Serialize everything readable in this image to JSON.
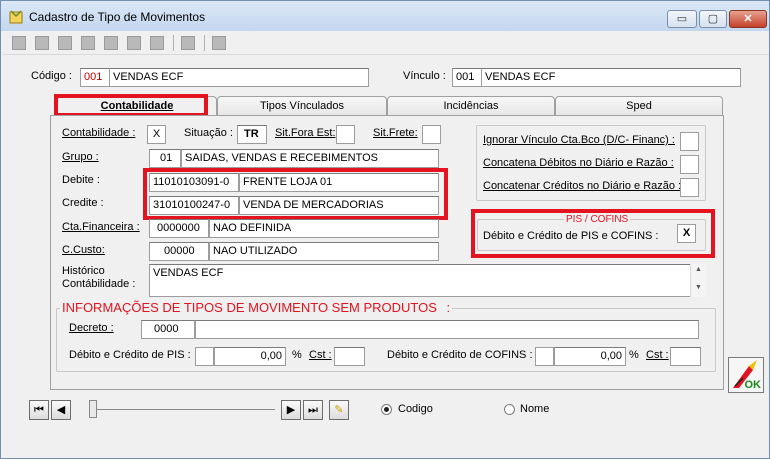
{
  "window": {
    "title": "Cadastro de Tipo de Movimentos",
    "min_glyph": "▭",
    "max_glyph": "▢",
    "close_glyph": "✕"
  },
  "header": {
    "codigo_label": "Código :",
    "codigo_code": "001",
    "codigo_desc": "VENDAS ECF",
    "vinculo_label": "Vínculo :",
    "vinculo_code": "001",
    "vinculo_desc": "VENDAS ECF"
  },
  "tabs": [
    {
      "label": "Contabilidade",
      "active": true
    },
    {
      "label": "Tipos Vínculados",
      "active": false
    },
    {
      "label": "Incidências",
      "active": false
    },
    {
      "label": "Sped",
      "active": false
    }
  ],
  "contab": {
    "contabilidade_label": "Contabilidade :",
    "contabilidade_value": "X",
    "situacao_label": "Situação :",
    "situacao_value": "TR",
    "sit_fora_est_label": "Sit.Fora Est:",
    "sit_fora_est_value": "",
    "sit_frete_label": "Sit.Frete:",
    "sit_frete_value": "",
    "grupo_label": "Grupo :",
    "grupo_code": "01",
    "grupo_desc": "SAIDAS, VENDAS E RECEBIMENTOS",
    "debite_label": "Debite :",
    "debite_code": "11010103091-0",
    "debite_desc": "FRENTE LOJA 01",
    "credite_label": "Credite :",
    "credite_code": "31010100247-0",
    "credite_desc": "VENDA DE MERCADORIAS",
    "cta_fin_label": "Cta.Financeira :",
    "cta_fin_code": "0000000",
    "cta_fin_desc": "NAO DEFINIDA",
    "ccusto_label": "C.Custo:",
    "ccusto_code": "00000",
    "ccusto_desc": "NAO UTILIZADO",
    "historico_label_1": "Histórico",
    "historico_label_2": "Contábilidade :",
    "historico_value": "VENDAS ECF"
  },
  "options": {
    "ignorar_label": "Ignorar Vínculo Cta.Bco (D/C- Financ) :",
    "ignorar_value": "",
    "concatena_label": "Concatena Débitos  no Diário e Razão :",
    "concatena_value": "",
    "concatenar_label": "Concatenar Créditos no Diário e Razão :",
    "concatenar_value": ""
  },
  "pis_cofins": {
    "title": "PIS / COFINS",
    "label": "Débito e Crédito de PIS e COFINS :",
    "value": "X"
  },
  "sem_produtos": {
    "title": "INFORMAÇÕES DE TIPOS DE MOVIMENTO SEM PRODUTOS",
    "title_suffix": ":",
    "decreto_label": "Decreto :",
    "decreto_code": "0000",
    "decreto_desc": "",
    "pis_label": "Débito e Crédito de PIS :",
    "pis_flag": "",
    "pis_value": "0,00",
    "pis_pct": "%",
    "pis_cst_label": "Cst :",
    "pis_cst_value": "",
    "cofins_label": "Débito e Crédito de COFINS :",
    "cofins_flag": "",
    "cofins_value": "0,00",
    "cofins_pct": "%",
    "cofins_cst_label": "Cst :",
    "cofins_cst_value": ""
  },
  "navigation": {
    "first_glyph": "⏮",
    "prev_glyph": "◀",
    "next_glyph": "▶",
    "last_glyph": "⏭",
    "edit_glyph": "✎"
  },
  "sort": {
    "codigo_label": "Codigo",
    "codigo_selected": true,
    "nome_label": "Nome",
    "nome_selected": false
  },
  "ok_button": {
    "label": "OK"
  },
  "colors": {
    "highlight": "#e3131f",
    "code_red": "#c00000",
    "section_title": "#e3131f"
  }
}
